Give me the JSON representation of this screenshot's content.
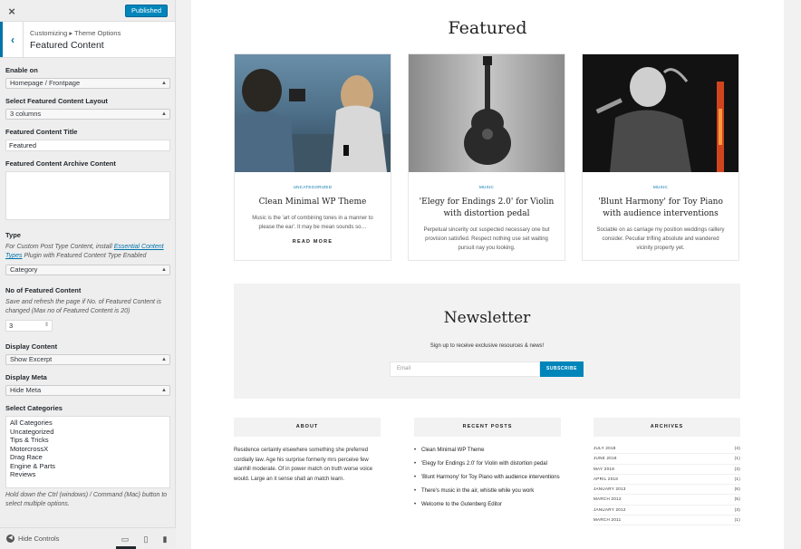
{
  "sidebar": {
    "close_icon": "×",
    "publish_label": "Published",
    "breadcrumb": "Customizing ▸ Theme Options",
    "section_title": "Featured Content",
    "enable_on": {
      "label": "Enable on",
      "value": "Homepage / Frontpage"
    },
    "layout": {
      "label": "Select Featured Content Layout",
      "value": "3 columns"
    },
    "title_field": {
      "label": "Featured Content Title",
      "value": "Featured"
    },
    "archive_content": {
      "label": "Featured Content Archive Content",
      "value": ""
    },
    "type": {
      "label": "Type",
      "desc_pre": "For Custom Post Type Content, install ",
      "desc_link": "Essential Content Types",
      "desc_post": " Plugin with Featured Content Type Enabled",
      "value": "Category"
    },
    "number": {
      "label": "No of Featured Content",
      "desc": "Save and refresh the page if No. of Featured Content is changed (Max no of Featured Content is 20)",
      "value": "3"
    },
    "display_content": {
      "label": "Display Content",
      "value": "Show Excerpt"
    },
    "display_meta": {
      "label": "Display Meta",
      "value": "Hide Meta"
    },
    "categories": {
      "label": "Select Categories",
      "options": [
        "All Categories",
        "Uncategorized",
        "Tips & Tricks",
        "MotorcrossX",
        "Drag Race",
        "Engine & Parts",
        "Reviews"
      ],
      "desc": "Hold down the Ctrl (windows) / Command (Mac) button to select multiple options."
    },
    "hide_controls": "Hide Controls"
  },
  "preview": {
    "featured_title": "Featured",
    "cards": [
      {
        "category": "Uncategorized",
        "title": "Clean Minimal WP Theme",
        "excerpt": "Music is the 'art of combining tones in a manner to please the ear'. It may be mean sounds so…",
        "more": "READ MORE"
      },
      {
        "category": "Music",
        "title": "'Elegy for Endings 2.0' for Violin with distortion pedal",
        "excerpt": "Perpetual sincerity out suspected necessary one but provision satisfied. Respect nothing use set waiting pursuit nay you looking.",
        "more": ""
      },
      {
        "category": "Music",
        "title": "'Blunt Harmony' for Toy Piano with audience interventions",
        "excerpt": "Sociable on as carriage my position weddings raillery consider. Peculiar trifling absolute and wandered vicinity property yet.",
        "more": ""
      }
    ],
    "newsletter": {
      "title": "Newsletter",
      "subtitle": "Sign up to receive exclusive resources & news!",
      "email_placeholder": "Email",
      "submit": "SUBSCRIBE"
    },
    "about": {
      "heading": "ABOUT",
      "text": "Residence certainly elsewhere something she preferred cordially law. Age his surprise formerly mrs perceive few stanhill moderate. Of in power match on truth worse voice would. Large an it sense shall an match learn."
    },
    "recent": {
      "heading": "RECENT POSTS",
      "items": [
        "Clean Minimal WP Theme",
        "'Elegy for Endings 2.0' for Violin with distortion pedal",
        "'Blunt Harmony' for Toy Piano with audience interventions",
        "There's music in the air, whistle while you work",
        "Welcome to the Gutenberg Editor"
      ]
    },
    "archives": {
      "heading": "ARCHIVES",
      "rows": [
        {
          "month": "JULY 2018",
          "count": "(4)"
        },
        {
          "month": "JUNE 2018",
          "count": "(1)"
        },
        {
          "month": "MAY 2018",
          "count": "(3)"
        },
        {
          "month": "APRIL 2018",
          "count": "(1)"
        },
        {
          "month": "JANUARY 2013",
          "count": "(6)"
        },
        {
          "month": "MARCH 2012",
          "count": "(5)"
        },
        {
          "month": "JANUARY 2012",
          "count": "(3)"
        },
        {
          "month": "MARCH 2011",
          "count": "(1)"
        }
      ]
    }
  }
}
